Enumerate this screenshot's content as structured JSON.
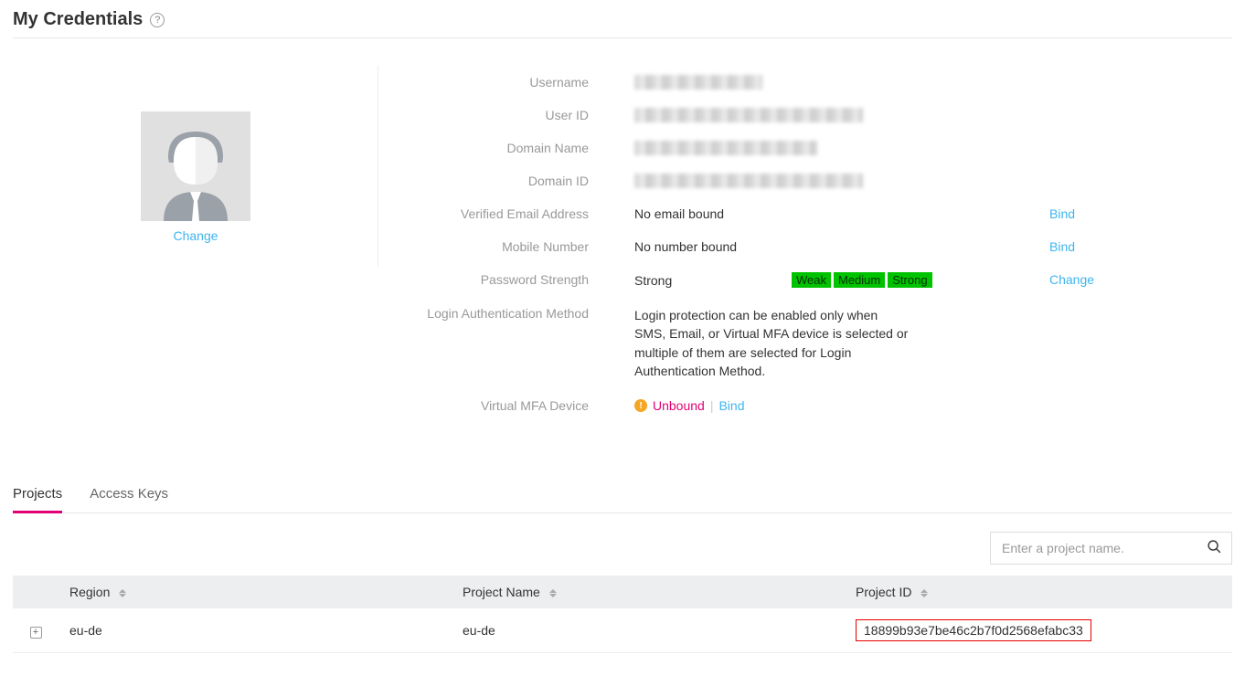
{
  "header": {
    "title": "My Credentials"
  },
  "avatar": {
    "change_label": "Change"
  },
  "fields": {
    "username": {
      "label": "Username"
    },
    "user_id": {
      "label": "User ID"
    },
    "domain_name": {
      "label": "Domain Name"
    },
    "domain_id": {
      "label": "Domain ID"
    },
    "email": {
      "label": "Verified Email Address",
      "value": "No email bound",
      "action": "Bind"
    },
    "mobile": {
      "label": "Mobile Number",
      "value": "No number bound",
      "action": "Bind"
    },
    "password": {
      "label": "Password Strength",
      "value": "Strong",
      "levels": [
        "Weak",
        "Medium",
        "Strong"
      ],
      "action": "Change"
    },
    "login_auth": {
      "label": "Login Authentication Method",
      "value": "Login protection can be enabled only when SMS, Email, or Virtual MFA device is selected or multiple of them are selected for Login Authentication Method."
    },
    "mfa": {
      "label": "Virtual MFA Device",
      "status": "Unbound",
      "separator": "|",
      "action": "Bind"
    }
  },
  "tabs": {
    "projects": "Projects",
    "access_keys": "Access Keys"
  },
  "search": {
    "placeholder": "Enter a project name."
  },
  "table": {
    "headers": {
      "region": "Region",
      "project_name": "Project Name",
      "project_id": "Project ID"
    },
    "row": {
      "region": "eu-de",
      "project_name": "eu-de",
      "project_id": "18899b93e7be46c2b7f0d2568efabc33"
    }
  }
}
